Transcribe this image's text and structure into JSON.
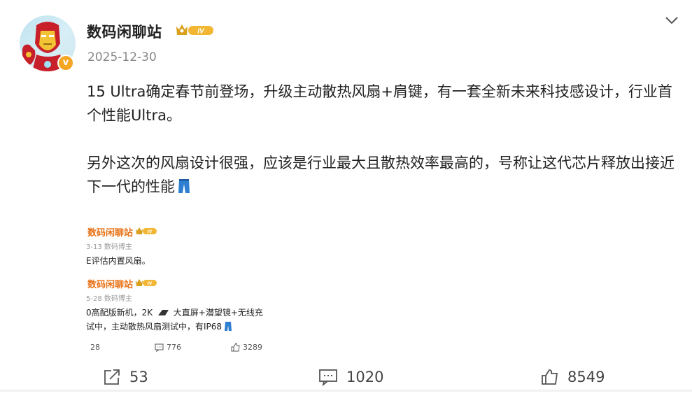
{
  "author": {
    "name": "数码闲聊站",
    "level": "IV"
  },
  "post": {
    "date": "2025-12-30",
    "paragraph1": "15 Ultra确定春节前登场，升级主动散热风扇+肩键，有一套全新未来科技感设计，行业首个性能Ultra。",
    "paragraph2": "另外这次的风扇设计很强，应该是行业最大且散热效率最高的，号称让这代芯片释放出接近下一代的性能"
  },
  "quote": {
    "post1_name": "数码闲聊站",
    "post1_meta": "3-13  数码博主",
    "post1_text": "E评估内置风扇。",
    "post2_name": "数码闲聊站",
    "post2_meta": "5-28  数码博主",
    "post2_line1": "0高配版新机，2K",
    "post2_line1b": "大直屏+潜望镜+无线充",
    "post2_line2": "试中，主动散热风扇测试中，有IP68",
    "reposts": "28",
    "comments": "776",
    "likes": "3289",
    "level": "IV"
  },
  "actions": {
    "reposts": "53",
    "comments": "1020",
    "likes": "8549"
  },
  "icons": {
    "more": "chevron-down-icon",
    "repost": "share-icon",
    "comment": "comment-icon",
    "like": "thumbs-up-icon",
    "emoji": "jeans-icon"
  },
  "colors": {
    "username": "#222222",
    "date": "#888888",
    "quote_name": "#e8741a",
    "verified": "#f5a623"
  }
}
